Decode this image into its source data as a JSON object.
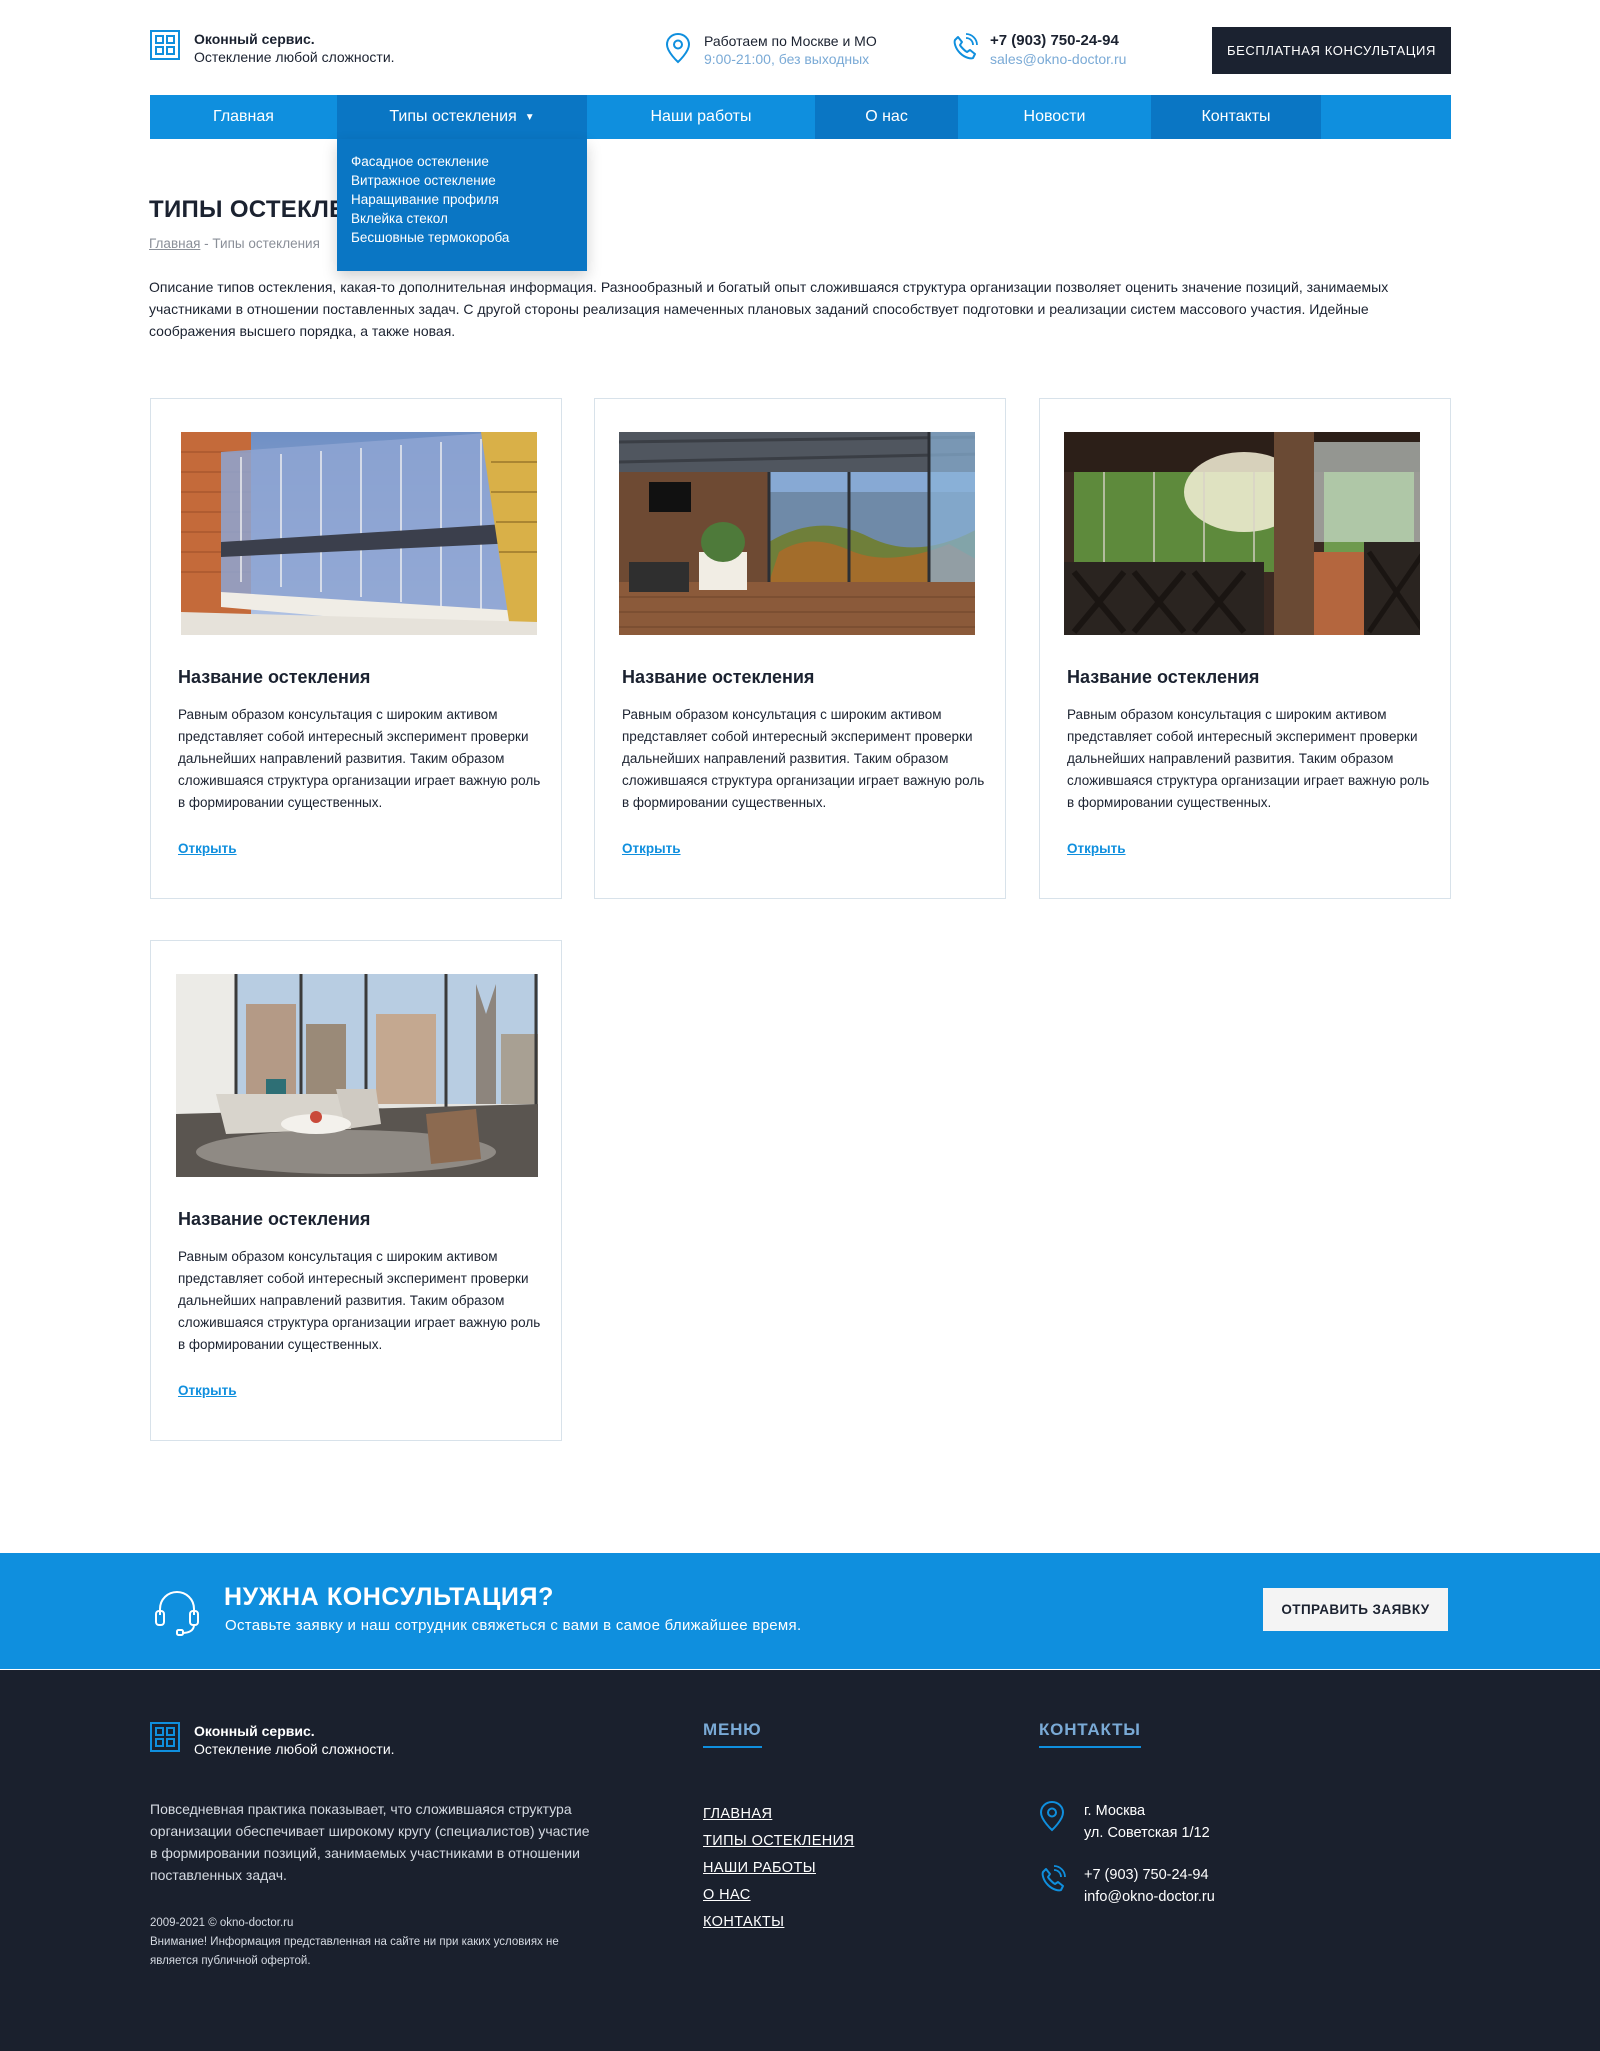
{
  "header": {
    "logo": {
      "name": "Оконный сервис.",
      "tagline": "Остекление любой сложности."
    },
    "address": {
      "line1": "Работаем по Москве и МО",
      "line2": "9:00-21:00, без выходных"
    },
    "phone": {
      "number": "+7 (903) 750-24-94",
      "email": "sales@okno-doctor.ru"
    },
    "consult_button": "Бесплатная консультация"
  },
  "nav": {
    "items": [
      {
        "label": "Главная"
      },
      {
        "label": "Типы остекления",
        "caret": "▼"
      },
      {
        "label": "Наши работы"
      },
      {
        "label": "О нас"
      },
      {
        "label": "Новости"
      },
      {
        "label": "Контакты"
      }
    ],
    "dropdown": [
      "Фасадное остекление",
      "Витражное остекление",
      "Наращивание профиля",
      "Вклейка стекол",
      "Бесшовные термокороба"
    ]
  },
  "page": {
    "title": "ТИПЫ ОСТЕКЛЕНИЯ",
    "breadcrumb": {
      "home": "Главная",
      "current": "- Типы остекления"
    },
    "intro": "Описание типов остекления, какая-то дополнительная информация. Разнообразный и богатый опыт сложившаяся структура организации позволяет оценить значение позиций, занимаемых участниками в отношении поставленных задач. С другой стороны реализация намеченных плановых заданий способствует подготовки и реализации систем массового участия. Идейные соображения высшего порядка, а также новая."
  },
  "cards": [
    {
      "title": "Название остекления",
      "text": "Равным образом консультация с широким активом представляет собой интересный эксперимент проверки дальнейших направлений развития. Таким образом сложившаяся структура организации играет важную роль в формировании существенных.",
      "link": "Открыть"
    },
    {
      "title": "Название остекления",
      "text": "Равным образом консультация с широким активом представляет собой интересный эксперимент проверки дальнейших направлений развития. Таким образом сложившаяся структура организации играет важную роль в формировании существенных.",
      "link": "Открыть"
    },
    {
      "title": "Название остекления",
      "text": "Равным образом консультация с широким активом представляет собой интересный эксперимент проверки дальнейших направлений развития. Таким образом сложившаяся структура организации играет важную роль в формировании существенных.",
      "link": "Открыть"
    },
    {
      "title": "Название остекления",
      "text": "Равным образом консультация с широким активом представляет собой интересный эксперимент проверки дальнейших направлений развития. Таким образом сложившаяся структура организации играет важную роль в формировании существенных.",
      "link": "Открыть"
    }
  ],
  "cta": {
    "title": "НУЖНА КОНСУЛЬТАЦИЯ?",
    "subtitle": "Оставьте заявку и наш сотрудник свяжеться с вами в самое ближайшее время.",
    "button": "Отправить заявку"
  },
  "footer": {
    "logo": {
      "name": "Оконный сервис.",
      "tagline": "Остекление любой сложности."
    },
    "about": "Повседневная практика показывает, что сложившаяся структура организации обеспечивает широкому кругу (специалистов) участие в формировании позиций, занимаемых участниками в отношении поставленных задач.",
    "copyright": "2009-2021  © okno-doctor.ru",
    "disclaimer": "Внимание! Информация представленная на сайте ни при каких условиях не является публичной офертой.",
    "menu_title": "Меню",
    "menu": [
      "Главная",
      "Типы остекления",
      "Наши работы",
      "О нас",
      "Контакты"
    ],
    "contacts_title": "Контакты",
    "address": {
      "city": "г. Москва",
      "street": "ул. Советская 1/12"
    },
    "phone": {
      "number": "+7 (903) 750-24-94",
      "email": "info@okno-doctor.ru"
    }
  },
  "colors": {
    "accent": "#0f8fde",
    "accent_dark": "#0a76c4",
    "dark": "#1b2230",
    "footer_bg": "#1a202d",
    "muted_blue": "#7aaad6"
  },
  "icons": [
    "window-logo-icon",
    "map-pin-icon",
    "phone-icon",
    "headset-icon"
  ]
}
